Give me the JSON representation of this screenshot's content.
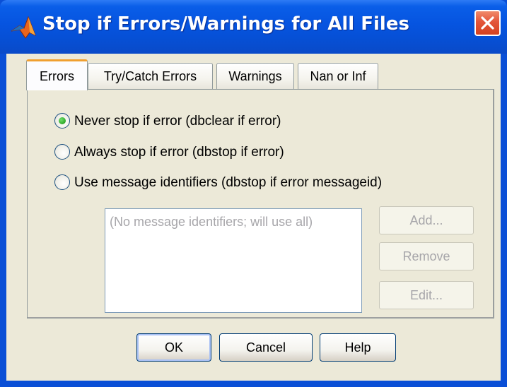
{
  "window": {
    "title": "Stop if Errors/Warnings for All Files",
    "icon": "matlab-logo-icon",
    "close_icon": "close-icon"
  },
  "tabs": [
    {
      "label": "Errors",
      "active": true
    },
    {
      "label": "Try/Catch Errors",
      "active": false
    },
    {
      "label": "Warnings",
      "active": false
    },
    {
      "label": "Nan or Inf",
      "active": false
    }
  ],
  "errors_tab": {
    "options": [
      {
        "label": "Never stop if error (dbclear if error)",
        "selected": true
      },
      {
        "label": "Always stop if error (dbstop if error)",
        "selected": false
      },
      {
        "label": "Use message identifiers (dbstop if error messageid)",
        "selected": false
      }
    ],
    "identifiers_list": {
      "placeholder": "(No message identifiers; will use all)"
    },
    "add_label": "Add...",
    "remove_label": "Remove",
    "edit_label": "Edit..."
  },
  "buttons": {
    "ok": "OK",
    "cancel": "Cancel",
    "help": "Help"
  },
  "colors": {
    "titlebar": "#0654e0",
    "dialog_bg": "#ece9d8",
    "selected_radio": "#2fa82a",
    "active_tab_accent": "#f0a030",
    "close_button": "#e3553a"
  }
}
